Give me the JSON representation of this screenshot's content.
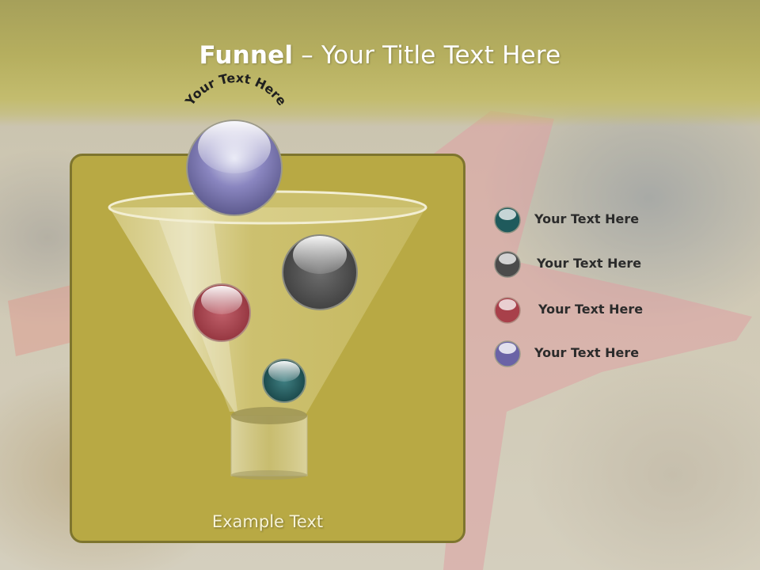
{
  "slide": {
    "title_bold": "Funnel",
    "title_rest": " – Your Title Text Here",
    "arc_text": "Your Text Here",
    "bottom_label": "Example Text"
  },
  "legend": [
    {
      "label": "Your  Text Here",
      "color": "#1f5a5c"
    },
    {
      "label": "Your  Text Here",
      "color": "#4b4b4b"
    },
    {
      "label": "Your  Text Here",
      "color": "#a8404a"
    },
    {
      "label": "Your  Text Here",
      "color": "#6a63a6"
    }
  ],
  "colors": {
    "title_band": "#b6af5f",
    "panel": "#b8a944",
    "panel_border": "#7e752e",
    "title_text": "#ffffff"
  }
}
